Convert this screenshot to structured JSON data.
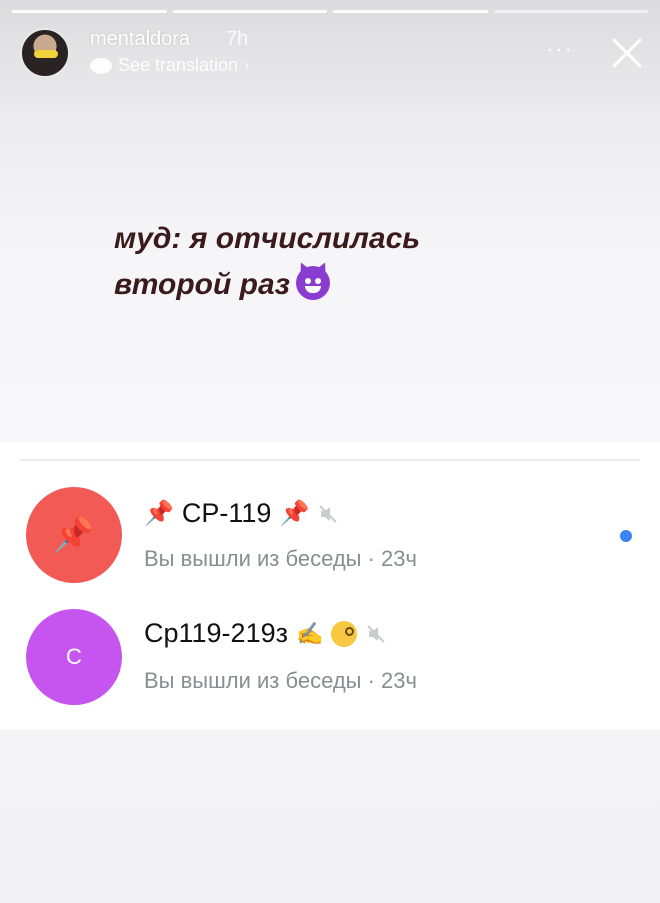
{
  "story": {
    "username": "mentaldora",
    "time": "7h",
    "translation_label": "See translation",
    "more_label": "···",
    "caption_line1": "муд: я отчислилась",
    "caption_line2": "второй раз"
  },
  "chats": [
    {
      "title": "СР-119",
      "subtitle": "Вы вышли из беседы · 23ч",
      "avatar_color": "#f25a55",
      "icons": [
        "pushpin-icon",
        "mute-icon"
      ],
      "unread": true
    },
    {
      "title": "Ср119-219з",
      "avatar_letter": "С",
      "subtitle": "Вы вышли из беседы · 23ч",
      "avatar_color": "#c655f0",
      "icons": [
        "writing-hand-icon",
        "face-with-monocle-icon",
        "mute-icon"
      ]
    }
  ],
  "colors": {
    "unread_dot": "#3a85f2",
    "caption_text": "#3a1a1c"
  }
}
